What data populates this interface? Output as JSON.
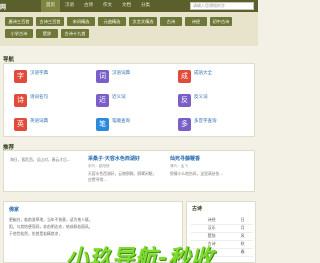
{
  "header": {
    "logo": "网",
    "nav": [
      "首页",
      "汉语",
      "古诗",
      "作文",
      "文档",
      "分类"
    ],
    "search_placeholder": "请输入您想搜的字"
  },
  "categories": [
    "唐诗三百首",
    "古诗三百首",
    "宋词精选",
    "元曲精选",
    "文言文精选",
    "古诗",
    "诗经",
    "初中古诗",
    "小学古诗",
    "楚辞",
    "古诗十九首"
  ],
  "tools": {
    "title": "导航",
    "items": [
      {
        "name": "汉语字典",
        "desc": "",
        "color": "#e14b3b",
        "icon": "字"
      },
      {
        "name": "汉语词典",
        "desc": "",
        "color": "#7a5fc8",
        "icon": "词"
      },
      {
        "name": "成语大全",
        "desc": "",
        "color": "#e14b3b",
        "icon": "成"
      },
      {
        "name": "诗词名句",
        "desc": "",
        "color": "#e14b3b",
        "icon": "诗"
      },
      {
        "name": "近义词",
        "desc": "",
        "color": "#7a5fc8",
        "icon": "近"
      },
      {
        "name": "反义词",
        "desc": "",
        "color": "#7a5fc8",
        "icon": "反"
      },
      {
        "name": "英语词典",
        "desc": "",
        "color": "#e14b3b",
        "icon": "英"
      },
      {
        "name": "笔顺查询",
        "desc": "",
        "color": "#2a8ae0",
        "icon": "笔"
      },
      {
        "name": "多音字查询",
        "desc": "",
        "color": "#7a5fc8",
        "icon": "多"
      }
    ]
  },
  "recommend": {
    "title": "推荐",
    "items": [
      {
        "title": "",
        "meta": "",
        "body": "海日，孤危西，远山对，春云才后..."
      },
      {
        "title": "采桑子·天容水色西湖好",
        "meta": "宋代：欧阳修",
        "body": "天容水色西湖好，云物俱鲜。鸥鹭闲眠，应惯寻常..."
      },
      {
        "title": "灿死寻藤鞭香",
        "meta": "清代：孟飞",
        "body": "恨情小么地伤风，这里高处伤..."
      }
    ]
  },
  "lower": {
    "title": "佛家",
    "lines": [
      "更幽谷，临前流草地，当年不快意，读为他人赋。",
      "阻，与其恰便而同，非由明达亦，结成佩若丽风。",
      "于他世若然，伤首是若精良凉，"
    ]
  },
  "side": {
    "title": "古诗",
    "rows": [
      [
        "诗经",
        "日"
      ],
      [
        "汉乐",
        "月"
      ],
      [
        "楚辞",
        "风"
      ],
      [
        "古诗",
        "秋"
      ],
      [
        "唐诗",
        "春"
      ]
    ]
  },
  "watermark": "小玖导航-秒收"
}
